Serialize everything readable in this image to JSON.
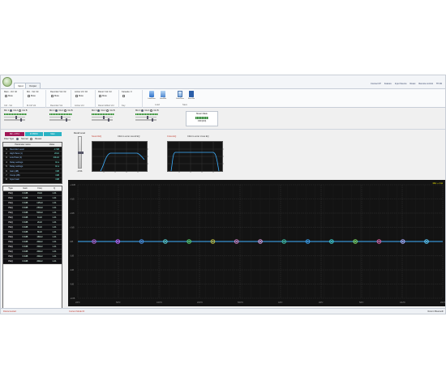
{
  "tabs": [
    "Input",
    "Output"
  ],
  "menu": [
    "Connect IP",
    "Feature",
    "Input Source",
    "Reset",
    "Remote control",
    "TP-84"
  ],
  "ribbon": {
    "groups": [
      {
        "label": "Main - Vol: 0d",
        "mute": "Mute",
        "foot": "Ctrl - Vol"
      },
      {
        "label": "Mic - Vol: 0d",
        "mute": "Mute",
        "foot": "M.Ctrl Vol"
      },
      {
        "label": "Recorder Vol: 0d",
        "mute": "Mute",
        "foot": "Recorder Vol"
      },
      {
        "label": "Active Vol: 0d",
        "mute": "Mute",
        "foot": "Active Vol"
      },
      {
        "label": "Return Vol: 0d",
        "mute": "Mute",
        "foot": "Return Effect Vol"
      },
      {
        "label": "Karaoke: 0",
        "mute": "",
        "foot": "Key"
      }
    ],
    "buttons": [
      "Load/Save",
      "Load/File",
      "Save/Save",
      "Save/File"
    ],
    "sub_labels": [
      "Load",
      "Save"
    ]
  },
  "channels": [
    {
      "name": "Mic 1",
      "opt1": "CH A",
      "opt2": "CH B"
    },
    {
      "name": "Mic 2",
      "opt1": "CH A",
      "opt2": "CH B"
    },
    {
      "name": "Mic 3",
      "opt1": "CH A",
      "opt2": "CH B"
    },
    {
      "name": "Mic 4",
      "opt1": "CH A",
      "opt2": "CH B"
    }
  ],
  "music_mask": {
    "title": "Music Mask",
    "value": "OFF(0/0)"
  },
  "left_panel": {
    "buttons": [
      "Mic + CH A",
      "IN PROC",
      "Main"
    ],
    "filter_type_label": "Filter Type",
    "filter_opt1": "Normal",
    "filter_opt2": "Bessel",
    "param_headers": [
      "Parameter name",
      "Value"
    ],
    "params": [
      [
        "Recorder Level",
        "-17dB"
      ],
      [
        "High Pass (1)",
        "20Hz"
      ],
      [
        "Low Pass (1)",
        "20kHz"
      ],
      [
        "Delay settings",
        "0ms"
      ],
      [
        "Delay settings",
        "0ms"
      ],
      [
        "Gain (dB)",
        "0dB"
      ],
      [
        "Comp (dB)",
        "0dB"
      ],
      [
        "Input Gain",
        "0dB"
      ]
    ],
    "eq_headers": [
      "Type",
      "Gain",
      "Freq",
      "Q"
    ],
    "eq_rows": [
      [
        "PEQ",
        "0.0dB",
        "31Hz",
        "1.41"
      ],
      [
        "PEQ",
        "0.0dB",
        "63Hz",
        "1.41"
      ],
      [
        "PEQ",
        "0.0dB",
        "125Hz",
        "1.41"
      ],
      [
        "PEQ",
        "0.0dB",
        "250Hz",
        "1.41"
      ],
      [
        "PEQ",
        "0.0dB",
        "500Hz",
        "1.41"
      ],
      [
        "PEQ",
        "0.0dB",
        "1kHz",
        "1.41"
      ],
      [
        "PEQ",
        "0.0dB",
        "2kHz",
        "1.41"
      ],
      [
        "PEQ",
        "0.0dB",
        "4kHz",
        "1.41"
      ],
      [
        "PEQ",
        "0.0dB",
        "8kHz",
        "1.41"
      ],
      [
        "PEQ",
        "0.0dB",
        "16kHz",
        "1.41"
      ],
      [
        "PEQ",
        "0.0dB",
        "20kHz",
        "1.41"
      ],
      [
        "PEQ",
        "0.0dB",
        "20kHz",
        "1.41"
      ],
      [
        "PEQ",
        "0.0dB",
        "20kHz",
        "1.41"
      ],
      [
        "PEQ",
        "0.0dB",
        "20kHz",
        "1.41"
      ],
      [
        "PEQ",
        "0.0dB",
        "20kHz",
        "1.41"
      ]
    ]
  },
  "recall": {
    "title": "Recall Level",
    "value": "-17db"
  },
  "mini_graphs": [
    {
      "tag": "Sound EQ",
      "hint": "Click to enter sound EQ"
    },
    {
      "tag": "Cross EQ",
      "hint": "Click to enter cross EQ"
    }
  ],
  "main_graph": {
    "mode_label": "Mic + CH",
    "y_ticks": [
      "+12dB",
      "+9dB",
      "+6dB",
      "+3dB",
      "0dB",
      "-3dB",
      "-6dB",
      "-9dB",
      "-12dB"
    ],
    "x_ticks": [
      "20Hz",
      "50Hz",
      "100Hz",
      "200Hz",
      "500Hz",
      "1kHz",
      "2kHz",
      "5kHz",
      "10kHz",
      "20kHz"
    ],
    "node_colors": [
      "#b05fd0",
      "#c060ff",
      "#4a8fe0",
      "#5ad1d1",
      "#59d46a",
      "#c0c040",
      "#d080c0",
      "#e0a0e0",
      "#40c0a0",
      "#3aa0f0",
      "#40d0d0",
      "#80e060",
      "#e060a0",
      "#b0b0ff",
      "#60d0ff"
    ],
    "line_color": "#3fb0ff"
  },
  "status": {
    "left": "Disconnected",
    "mid": "Current Mode:IO",
    "right": "Return  Bluetooth"
  }
}
